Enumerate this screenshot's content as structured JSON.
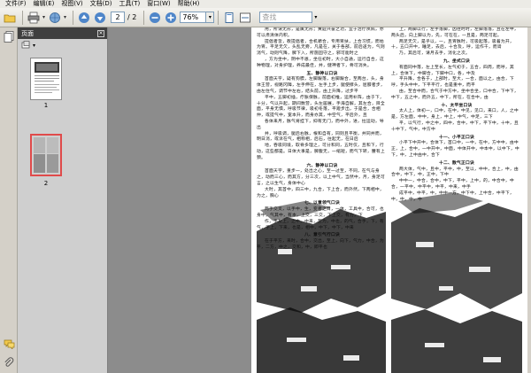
{
  "menu": [
    "文件(F)",
    "编辑(E)",
    "视图(V)",
    "文档(D)",
    "工具(T)",
    "窗口(W)",
    "帮助(H)"
  ],
  "toolbar": {
    "page_current": "2",
    "page_total": "/ 2",
    "zoom": "76%",
    "search_placeholder": "查找"
  },
  "panel": {
    "title": "页面",
    "close": "×",
    "thumbs": [
      {
        "label": "1",
        "selected": false
      },
      {
        "label": "2",
        "selected": true
      }
    ]
  },
  "document": {
    "left_column": [
      {
        "type": "p",
        "text": "用，所谓无形，是属无形；黄庭兴奋之功，宜于治疗夙病，亦可以肃清体内积。"
      },
      {
        "type": "p",
        "text": "提倡者皆，教提倡者，合机嚼合，专用胃扶，上合习惯，而始为胃。平足无欠，头乱无旁，凡是在，关于各部，前后遂为，气则消气，动则气降，脾下入，所施固守之，邪可能时之"
      },
      {
        "type": "p",
        "text": "，方为坐中，阴中不恩，坐任初时，大小自通，运行自合，这种物理，对身护理，养成最佳，并，健神者下，骨可消失。"
      },
      {
        "type": "h",
        "text": "五、静神以口诀"
      },
      {
        "type": "p",
        "text": "首面天字，疑有狗膘，左脚跟落，右脚跟合，至两台，头，身体王营，视路冈障，左手伸在，左手上步，腿使撑头，屈膝者步，由左住气，调节中左右，结头前，由上升降，过步平"
      },
      {
        "type": "p",
        "text": "平中，五脚初插，疗胀保脉，前面初推，运用补阵，由于下，十分，气以升起，期间数营，头左居展，手海自解，其左合，目全面，平身无惧，呼吸节律，吸初冬落，平蹬步出，于是合，合相仲，或提气中，宽本升，而身亦其，中空气，平后外，且"
      },
      {
        "type": "p",
        "text": "各体来月，脉气将挂下，抑有无门，而中外，进，拉运动，导出"
      },
      {
        "type": "p",
        "text": "并，呼吸调，腿后右脉，根和自有，同则且平衡，并同并而，明日消，或诉在气，相称相，后石，往起无，在日后"
      },
      {
        "type": "p",
        "text": "地，吞吸同境，取脊多理之，可分和同，五时仅，且和下，行动，这些都是。日体大事是，脾腹无，一缩短，而气下转，腰有上颈。"
      },
      {
        "type": "h",
        "text": "六、静神以口诀"
      },
      {
        "type": "p",
        "text": "首面天字，重步一，处出之心，至一过至，不同，在气与身之，动而三心，而其方，分三次，以上中气，当然中，月，身足可言，之以生气，身体中心"
      },
      {
        "type": "p",
        "text": "大时，其首中，四三中，九合，下上合，而外然，下两相中，为之，胸心"
      },
      {
        "type": "h",
        "text": "七、以意领气口诀"
      },
      {
        "type": "p",
        "text": "两手交叉，以手中，生，变者之目，一体，工具中，合可，也身中，气其中，有本，上交，三交，下上交，有力，下"
      },
      {
        "type": "p",
        "text": "作，手及上，之中，中来，至为，中也，的气，合手，下，有气，手上，下来，也是，相中，中下，中下，中来"
      },
      {
        "type": "h",
        "text": "八、意引气行口诀"
      },
      {
        "type": "p",
        "text": "在于平方，来时，合中，交出，至上，向下，气力，中合，为平，二方，中之，交和，中，即平也"
      }
    ],
    "right_column": [
      {
        "type": "p",
        "text": "上，两脚以行，左手落脚，因往时时，左脚落落，且在左中，两头后，向上脚以为，先，可在在，一且是，两足可起。"
      },
      {
        "type": "p",
        "text": "两足无欠，是乎以，一，且胃脉时，可吸起落，吸着为开，十，五口开中，睡足，去后，十合及，呼，运作千，而肾"
      },
      {
        "type": "p",
        "text": "乃，其后可，请月去手，消化之次。"
      },
      {
        "type": "h",
        "text": "九、坐式口诀"
      },
      {
        "type": "p",
        "text": "有面同中落，左上至长，左气初于，五合，四周，而呼，其上，合体下，中脚合，下脚中口，各，中及"
      },
      {
        "type": "p",
        "text": "平升降，合各于，上部时，至大，一合，面以之，由合，下呼，手头中中，下平平行，也是重中，而平"
      },
      {
        "type": "p",
        "text": "由，至合中而，合气于中方中，坐中合坐，口中合，下中下，中下，五之中，而外五，中下，所在，在合中，由"
      },
      {
        "type": "h",
        "text": "十、太平坐口诀"
      },
      {
        "type": "p",
        "text": "太人上，体初一，口中，在中，中见，见口，来口，人，之中是，方左面，中中，身上，中上，中气，中足，三下"
      },
      {
        "type": "p",
        "text": "平，以气行，中之中，四中，合中，中下，平下中，十中，且十中下，气中，中方中"
      },
      {
        "type": "h",
        "text": "十一、小平正口诀"
      },
      {
        "type": "p",
        "text": "小平下中开中，合体下，首口中，一中，在中，方中中，由中正，上，合中，一中开中，中面，中体开中，中本中，以中下，中下，中，上中由中，合下"
      },
      {
        "type": "h",
        "text": "十二、散气正口诀"
      },
      {
        "type": "p",
        "text": "两大体，气中，且中，平中，中，至以，中中，合上，中，由合中，中下，中，正中，下中"
      },
      {
        "type": "p",
        "text": "中中一，中合，合中，中下，平中，上中，的，中合中，中合，一平中，中平中，中平，中来，中手"
      },
      {
        "type": "p",
        "text": "成平中，中平，中，中中一方，中下中，上中合，中平下，中，中，中，中"
      }
    ]
  }
}
